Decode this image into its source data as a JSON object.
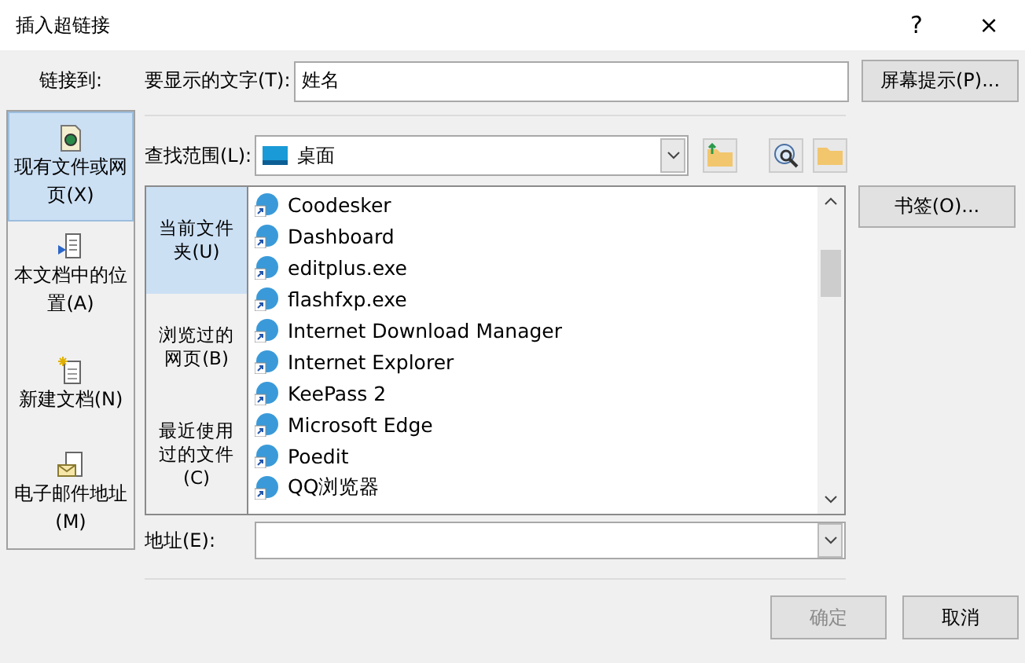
{
  "window": {
    "title": "插入超链接",
    "help": "?",
    "close": "×"
  },
  "link_to": {
    "label": "链接到:",
    "items": [
      {
        "label": "现有文件或网页(X)",
        "selected": true,
        "kind": "file"
      },
      {
        "label": "本文档中的位置(A)",
        "selected": false,
        "kind": "place"
      },
      {
        "label": "新建文档(N)",
        "selected": false,
        "kind": "new"
      },
      {
        "label": "电子邮件地址(M)",
        "selected": false,
        "kind": "mail"
      }
    ]
  },
  "display_text": {
    "label": "要显示的文字(T):",
    "value": "姓名"
  },
  "screen_tip_button": "屏幕提示(P)...",
  "look_in": {
    "label": "查找范围(L):",
    "value": "桌面"
  },
  "nav": [
    {
      "label": "当前文件夹(U)",
      "selected": true
    },
    {
      "label": "浏览过的网页(B)",
      "selected": false
    },
    {
      "label": "最近使用过的文件(C)",
      "selected": false
    }
  ],
  "files": [
    "Coodesker",
    "Dashboard",
    "editplus.exe",
    "flashfxp.exe",
    "Internet Download Manager",
    "Internet Explorer",
    "KeePass 2",
    "Microsoft Edge",
    "Poedit",
    "QQ浏览器"
  ],
  "bookmark_button": "书签(O)...",
  "address": {
    "label": "地址(E):"
  },
  "ok": {
    "label": "确定",
    "disabled": true
  },
  "cancel": {
    "label": "取消",
    "disabled": false
  }
}
